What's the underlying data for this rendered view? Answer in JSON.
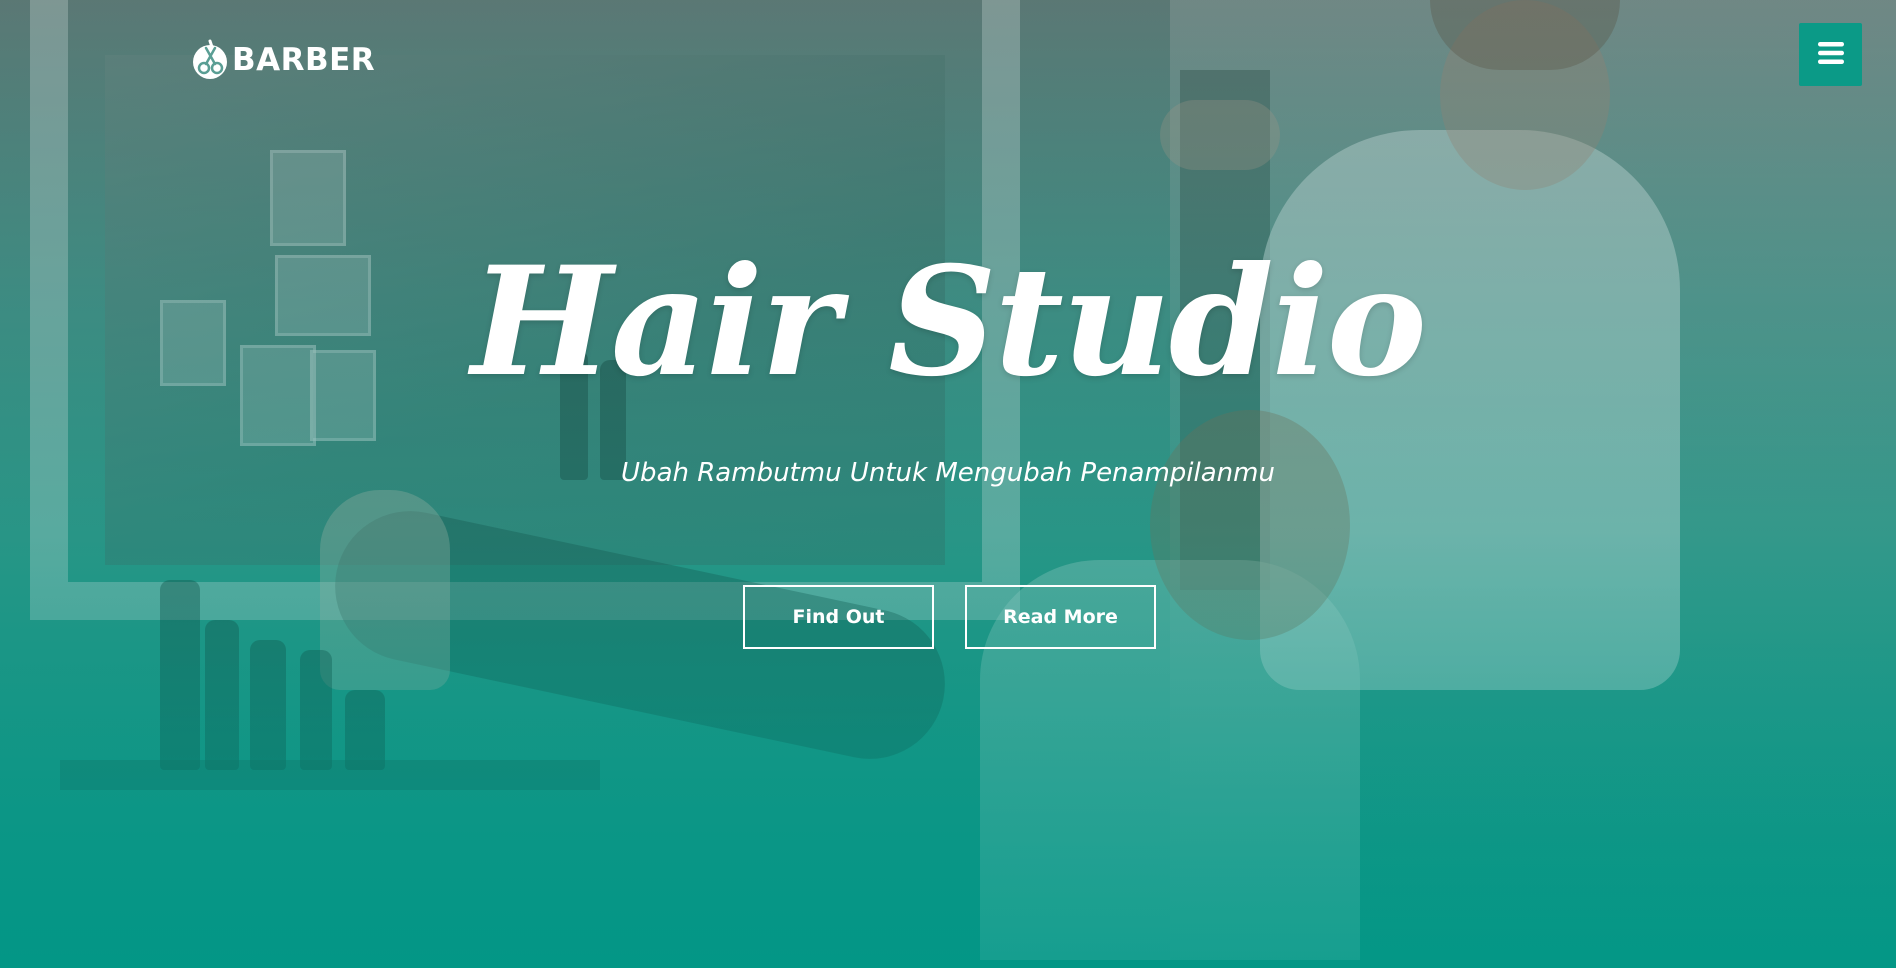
{
  "header": {
    "logo_text": "BARBER",
    "logo_icon": "scissors-icon",
    "menu_icon": "hamburger-menu-icon"
  },
  "hero": {
    "title": "Hair Studio",
    "subtitle": "Ubah Rambutmu Untuk Mengubah Penampilanmu",
    "buttons": [
      {
        "label": "Find Out"
      },
      {
        "label": "Read More"
      }
    ]
  },
  "colors": {
    "accent": "#0b9a87",
    "overlay_bottom": "#009686",
    "text": "#ffffff"
  }
}
